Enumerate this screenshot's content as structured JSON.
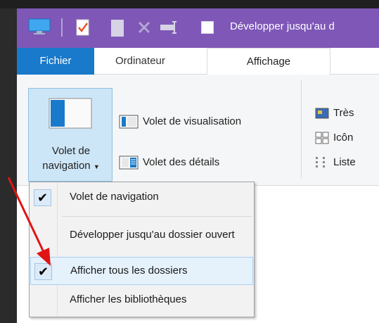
{
  "window": {
    "title": "Développer jusqu'au d"
  },
  "tabs": [
    {
      "label": "Fichier"
    },
    {
      "label": "Ordinateur"
    },
    {
      "label": "Affichage"
    }
  ],
  "ribbon": {
    "nav_pane_label_line1": "Volet de",
    "nav_pane_label_line2": "navigation",
    "preview_pane_label": "Volet de visualisation",
    "details_pane_label": "Volet des détails",
    "layout_items": [
      "Très",
      "Icôn",
      "Liste"
    ]
  },
  "menu": {
    "items": [
      {
        "label": "Volet de navigation",
        "checked": true
      },
      {
        "label": "Développer jusqu'au dossier ouvert",
        "checked": false
      },
      {
        "label": "Afficher tous les dossiers",
        "checked": true,
        "highlighted": true
      },
      {
        "label": "Afficher les bibliothèques",
        "checked": false
      }
    ],
    "check_glyph": "✔"
  },
  "colors": {
    "titlebar": "#7e57b7",
    "file_tab": "#1979ca",
    "highlight": "#e5f1fb",
    "annotation_arrow": "#e01414"
  }
}
